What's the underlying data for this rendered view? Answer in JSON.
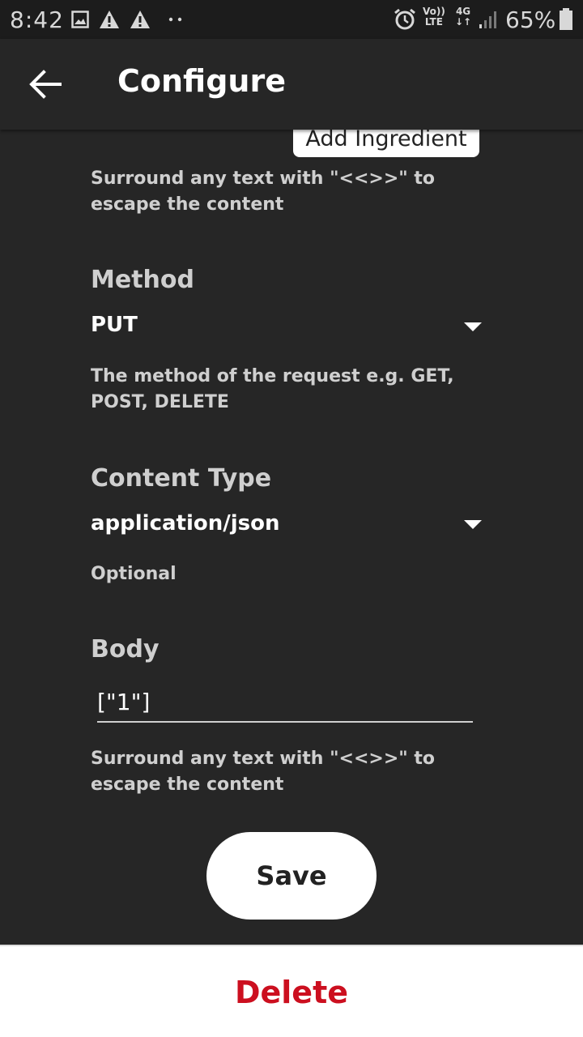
{
  "status_bar": {
    "time": "8:42",
    "battery_percent": "65%",
    "volte_line1": "Vo))",
    "volte_line2": "LTE",
    "network_type": "4G",
    "icons": [
      "image-icon",
      "warning-icon",
      "warning-icon",
      "more-dots-icon",
      "alarm-icon",
      "signal-icon",
      "battery-icon"
    ]
  },
  "app_bar": {
    "title": "Configure",
    "back_icon": "back-arrow-icon"
  },
  "form": {
    "add_ingredient_label": "Add Ingredient",
    "url_helper": "Surround any text with \"<<>>\" to escape the content",
    "method": {
      "label": "Method",
      "value": "PUT",
      "helper": "The method of the request e.g. GET, POST, DELETE"
    },
    "content_type": {
      "label": "Content Type",
      "value": "application/json",
      "helper": "Optional"
    },
    "body": {
      "label": "Body",
      "value": "[\"1\"]",
      "helper": "Surround any text with \"<<>>\" to escape the content"
    },
    "save_label": "Save"
  },
  "footer": {
    "delete_label": "Delete"
  },
  "colors": {
    "background": "#262626",
    "delete_red": "#cc0f1f",
    "button_white": "#ffffff"
  }
}
